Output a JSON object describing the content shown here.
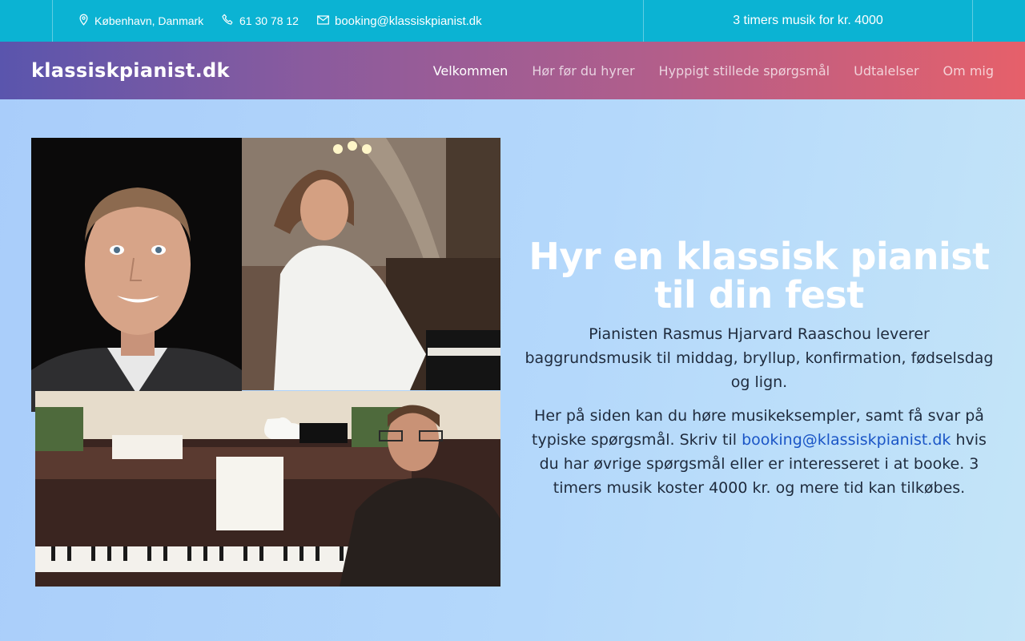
{
  "topbar": {
    "location": "København, Danmark",
    "phone": "61 30 78 12",
    "email": "booking@klassiskpianist.dk",
    "promo": "3 timers musik for kr. 4000",
    "icons": [
      "map-pin-icon",
      "phone-icon",
      "mail-icon"
    ],
    "bg_color": "#0bb3d3"
  },
  "nav": {
    "brand": "klassiskpianist.dk",
    "items": [
      {
        "label": "Velkommen",
        "active": true
      },
      {
        "label": "Hør før du hyrer",
        "active": false
      },
      {
        "label": "Hyppigt stillede spørgsmål",
        "active": false
      },
      {
        "label": "Udtalelser",
        "active": false
      },
      {
        "label": "Om mig",
        "active": false
      }
    ],
    "gradient": [
      "#5a55ad",
      "#e6606a"
    ]
  },
  "hero": {
    "title": "Hyr en klassisk pianist til din fest",
    "intro": "Pianisten Rasmus Hjarvard Raaschou leverer baggrundsmusik til middag, bryllup, konfirmation, fødselsdag og lign.",
    "body_before": "Her på siden kan du høre musikeksempler, samt få svar på typiske spørgsmål. Skriv til ",
    "body_link": "booking@klassiskpianist.dk",
    "body_after": " hvis du har øvrige spørgsmål eller er interesseret i at booke. 3 timers musik koster 4000 kr. og mere tid kan tilkøbes.",
    "link_color": "#1a55c6"
  },
  "collage": {
    "photos": [
      "portrait-photo",
      "church-piano-photo",
      "home-piano-photo"
    ]
  }
}
